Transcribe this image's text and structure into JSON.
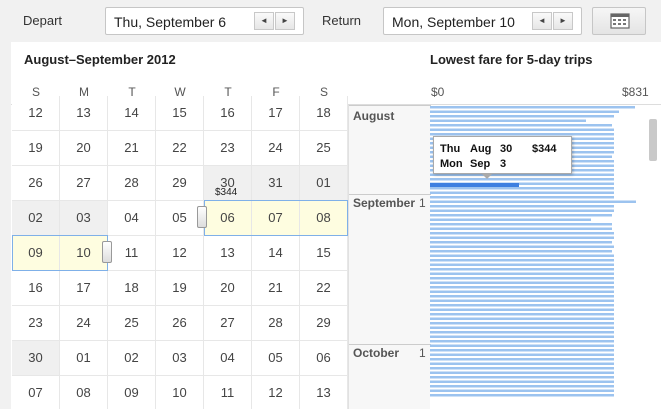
{
  "header": {
    "depart_label": "Depart",
    "depart_value": "Thu, September 6",
    "return_label": "Return",
    "return_value": "Mon, September 10",
    "prev": "◄",
    "next": "►"
  },
  "calendar": {
    "title": "August–September 2012",
    "weekdays": [
      "S",
      "M",
      "T",
      "W",
      "T",
      "F",
      "S"
    ],
    "weeks": [
      [
        "12",
        "13",
        "14",
        "15",
        "16",
        "17",
        "18"
      ],
      [
        "19",
        "20",
        "21",
        "22",
        "23",
        "24",
        "25"
      ],
      [
        "26",
        "27",
        "28",
        "29",
        "30",
        "31",
        "01"
      ],
      [
        "02",
        "03",
        "04",
        "05",
        "06",
        "07",
        "08"
      ],
      [
        "09",
        "10",
        "11",
        "12",
        "13",
        "14",
        "15"
      ],
      [
        "16",
        "17",
        "18",
        "19",
        "20",
        "21",
        "22"
      ],
      [
        "23",
        "24",
        "25",
        "26",
        "27",
        "28",
        "29"
      ],
      [
        "30",
        "01",
        "02",
        "03",
        "04",
        "05",
        "06"
      ],
      [
        "07",
        "08",
        "09",
        "10",
        "11",
        "12",
        "13"
      ]
    ],
    "fare_label": "$344"
  },
  "chart": {
    "title": "Lowest fare for 5-day trips",
    "axis_min": "$0",
    "axis_max": "$831",
    "months": [
      "August",
      "September",
      "October"
    ],
    "month_days": [
      "1",
      "1"
    ],
    "tooltip": {
      "line1": [
        "Thu",
        "Aug",
        "30",
        "$344"
      ],
      "line2": [
        "Mon",
        "Sep",
        "3"
      ]
    }
  },
  "chart_data": {
    "type": "bar",
    "title": "Lowest fare for 5-day trips",
    "xlim": [
      0,
      831
    ],
    "values": [
      790,
      726,
      706,
      599,
      699,
      706,
      706,
      706,
      706,
      706,
      706,
      700,
      706,
      706,
      706,
      706,
      706,
      706,
      706,
      706,
      706,
      791,
      706,
      706,
      700,
      620,
      700,
      700,
      706,
      706,
      700,
      706,
      700,
      706,
      706,
      706,
      706,
      706,
      706,
      706,
      706,
      706,
      706,
      706,
      706,
      706,
      706,
      706,
      706,
      706,
      706,
      706,
      706,
      706,
      706,
      706,
      706,
      706,
      706,
      706,
      706,
      706,
      706,
      706,
      706
    ],
    "selected": {
      "label": "Thu Aug 30 – Mon Sep 3",
      "value": 344
    },
    "bar_color": "#9cc3ef",
    "selected_color": "#3d7fe0"
  }
}
